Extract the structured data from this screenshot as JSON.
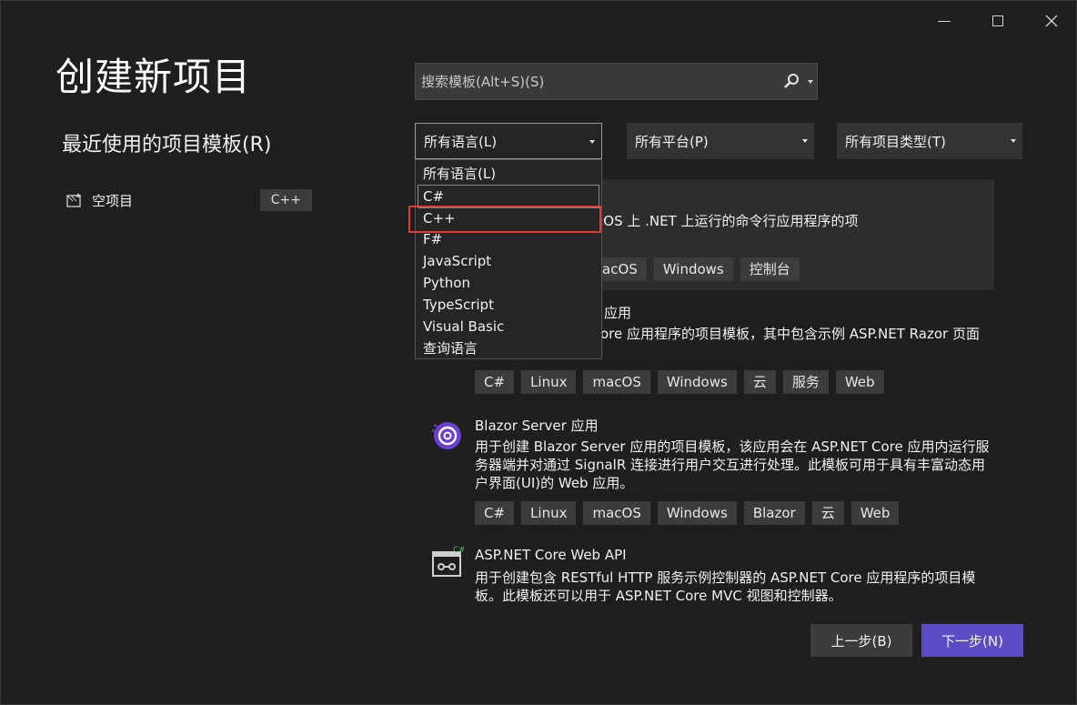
{
  "window": {
    "title": "创建新项目"
  },
  "recent": {
    "title": "最近使用的项目模板(R)",
    "items": [
      {
        "label": "空项目",
        "badge": "C++"
      }
    ]
  },
  "search": {
    "placeholder": "搜索模板(Alt+S)(S)"
  },
  "filters": {
    "language": "所有语言(L)",
    "platform": "所有平台(P)",
    "project_type": "所有项目类型(T)"
  },
  "language_dropdown": {
    "options": [
      "所有语言(L)",
      "C#",
      "C++",
      "F#",
      "JavaScript",
      "Python",
      "TypeScript",
      "Visual Basic",
      "查询语言"
    ],
    "highlighted": "C++"
  },
  "templates": [
    {
      "name": "",
      "desc": "ows、Linux 和 macOS 上 .NET 上运行的命令行应用程序的项",
      "tags": [
        "acOS",
        "Windows",
        "控制台"
      ]
    },
    {
      "name": "应用",
      "desc": "ore 应用程序的项目模板，其中包含示例 ASP.NET Razor 页面",
      "tags": [
        "C#",
        "Linux",
        "macOS",
        "Windows",
        "云",
        "服务",
        "Web"
      ]
    },
    {
      "name": "Blazor Server 应用",
      "desc": "用于创建 Blazor Server 应用的项目模板，该应用会在 ASP.NET Core 应用内运行服务器端并对通过 SignalR 连接进行用户交互进行处理。此模板可用于具有丰富动态用户界面(UI)的 Web 应用。",
      "tags": [
        "C#",
        "Linux",
        "macOS",
        "Windows",
        "Blazor",
        "云",
        "Web"
      ]
    },
    {
      "name": "ASP.NET Core Web API",
      "desc": "用于创建包含 RESTful HTTP 服务示例控制器的 ASP.NET Core 应用程序的项目模板。此模板还可以用于 ASP.NET Core MVC 视图和控制器。",
      "tags": []
    }
  ],
  "buttons": {
    "back": "上一步(B)",
    "next": "下一步(N)"
  },
  "colors": {
    "accent": "#5d4dc4",
    "highlight_border": "#e03c31"
  }
}
